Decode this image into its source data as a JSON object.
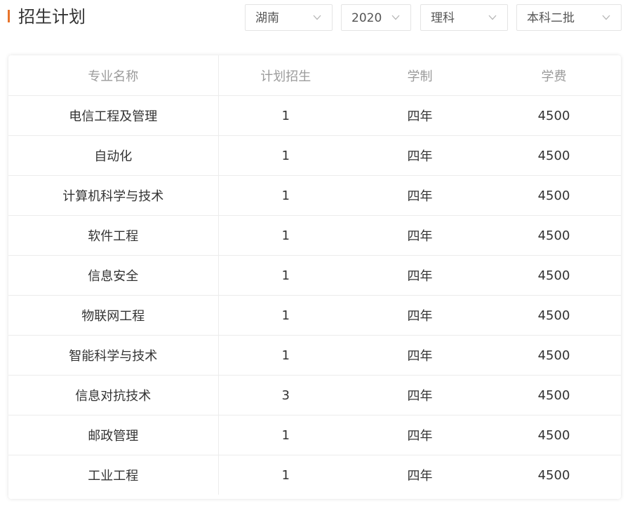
{
  "header": {
    "title": "招生计划",
    "accent_color": "#e8742b"
  },
  "filters": {
    "province": "湖南",
    "year": "2020",
    "subject": "理科",
    "batch": "本科二批"
  },
  "table": {
    "columns": [
      "专业名称",
      "计划招生",
      "学制",
      "学费"
    ],
    "rows": [
      {
        "major": "电信工程及管理",
        "plan": "1",
        "duration": "四年",
        "tuition": "4500"
      },
      {
        "major": "自动化",
        "plan": "1",
        "duration": "四年",
        "tuition": "4500"
      },
      {
        "major": "计算机科学与技术",
        "plan": "1",
        "duration": "四年",
        "tuition": "4500"
      },
      {
        "major": "软件工程",
        "plan": "1",
        "duration": "四年",
        "tuition": "4500"
      },
      {
        "major": "信息安全",
        "plan": "1",
        "duration": "四年",
        "tuition": "4500"
      },
      {
        "major": "物联网工程",
        "plan": "1",
        "duration": "四年",
        "tuition": "4500"
      },
      {
        "major": "智能科学与技术",
        "plan": "1",
        "duration": "四年",
        "tuition": "4500"
      },
      {
        "major": "信息对抗技术",
        "plan": "3",
        "duration": "四年",
        "tuition": "4500"
      },
      {
        "major": "邮政管理",
        "plan": "1",
        "duration": "四年",
        "tuition": "4500"
      },
      {
        "major": "工业工程",
        "plan": "1",
        "duration": "四年",
        "tuition": "4500"
      }
    ]
  }
}
